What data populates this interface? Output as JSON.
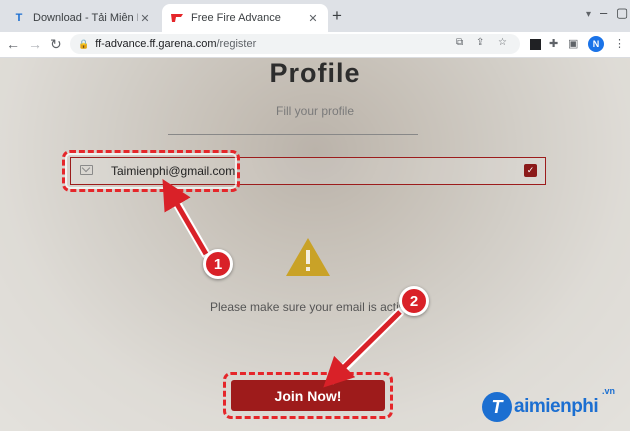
{
  "browser": {
    "tabs": [
      {
        "title": "Download - Tải Miễn Phí VN - Ph",
        "favicon": "T",
        "active": false
      },
      {
        "title": "Free Fire Advance",
        "favicon": "ff-logo",
        "active": true
      }
    ],
    "new_tab_glyph": "+",
    "url_host": "ff-advance.ff.garena.com",
    "url_path": "/register",
    "profile_initial": "N"
  },
  "page": {
    "title": "Profile",
    "subtitle": "Fill your profile",
    "email_value": "Taimienphi@gmail.com",
    "warning_message": "Please make sure your email is activ",
    "join_button": "Join Now!"
  },
  "annotations": {
    "badge1": "1",
    "badge2": "2",
    "highlight_color": "#e5262a"
  },
  "watermark": {
    "logo_letter": "T",
    "name": "aimienphi",
    "suffix": ".vn"
  },
  "colors": {
    "accent": "#9e1b1b",
    "warning": "#c9a227",
    "brand_blue": "#1c6fd1"
  }
}
